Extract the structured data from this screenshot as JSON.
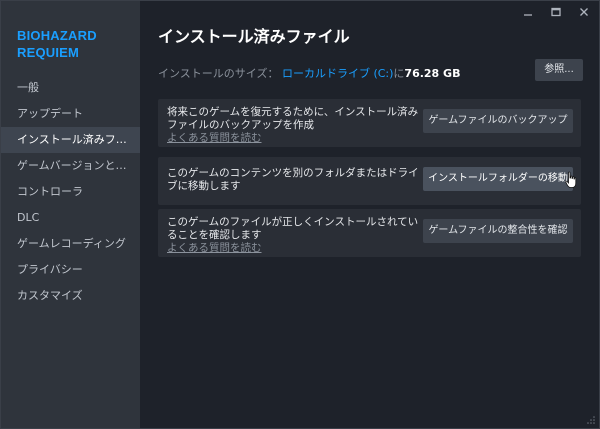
{
  "window": {
    "controls": {
      "minimize": "—",
      "maximize": "☐",
      "close": "✕"
    }
  },
  "sidebar": {
    "game_title": "BIOHAZARD REQUIEM",
    "items": [
      {
        "label": "一般"
      },
      {
        "label": "アップデート"
      },
      {
        "label": "インストール済みファイル"
      },
      {
        "label": "ゲームバージョンとベータ"
      },
      {
        "label": "コントローラ"
      },
      {
        "label": "DLC"
      },
      {
        "label": "ゲームレコーディング"
      },
      {
        "label": "プライバシー"
      },
      {
        "label": "カスタマイズ"
      }
    ],
    "active_index": 2
  },
  "main": {
    "title": "インストール済みファイル",
    "install_size_label": "インストールのサイズ：",
    "drive_link": "ローカルドライブ (C:)",
    "drive_suffix": "に",
    "size_value": "76.28 GB",
    "browse_button": "参照...",
    "cards": [
      {
        "text": "将来このゲームを復元するために、インストール済みファイルのバックアップを作成",
        "link": "よくある質問を読む",
        "button": "ゲームファイルのバックアップ"
      },
      {
        "text": "このゲームのコンテンツを別のフォルダまたはドライブに移動します",
        "link": "",
        "button": "インストールフォルダーの移動"
      },
      {
        "text": "このゲームのファイルが正しくインストールされていることを確認します",
        "link": "よくある質問を読む",
        "button": "ゲームファイルの整合性を確認"
      }
    ]
  }
}
